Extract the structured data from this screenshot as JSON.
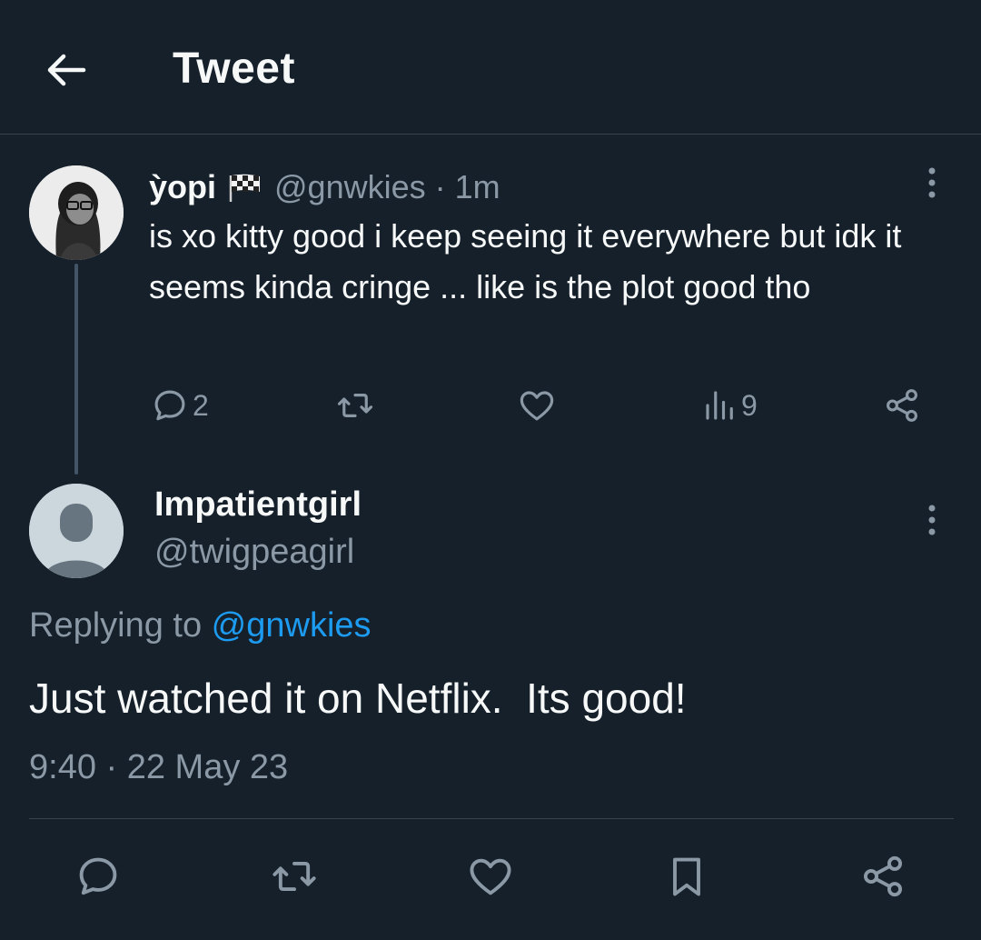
{
  "header": {
    "title": "Tweet"
  },
  "tweet": {
    "name": "ỳopi",
    "handle": "@gnwkies",
    "separator": " · ",
    "time": "1m",
    "text": "is xo kitty good i keep seeing it everywhere but idk it seems kinda cringe ... like is the plot good tho",
    "reply_count": "2",
    "views": "9"
  },
  "reply": {
    "name": "Impatientgirl",
    "handle": "@twigpeagirl",
    "replying_prefix": "Replying to ",
    "replying_mention": "@gnwkies",
    "text": "Just watched it on Netflix.  Its good!",
    "timestamp": "9:40 · 22 May 23"
  },
  "colors": {
    "background": "#15202b",
    "text": "#f7f9f9",
    "muted": "#8b98a5",
    "accent": "#1d9bf0",
    "divider": "#38444d"
  },
  "icons": [
    "back-arrow-icon",
    "checkered-flag-icon",
    "more-vertical-icon",
    "reply-icon",
    "retweet-icon",
    "like-icon",
    "views-icon",
    "share-icon",
    "bookmark-icon"
  ]
}
